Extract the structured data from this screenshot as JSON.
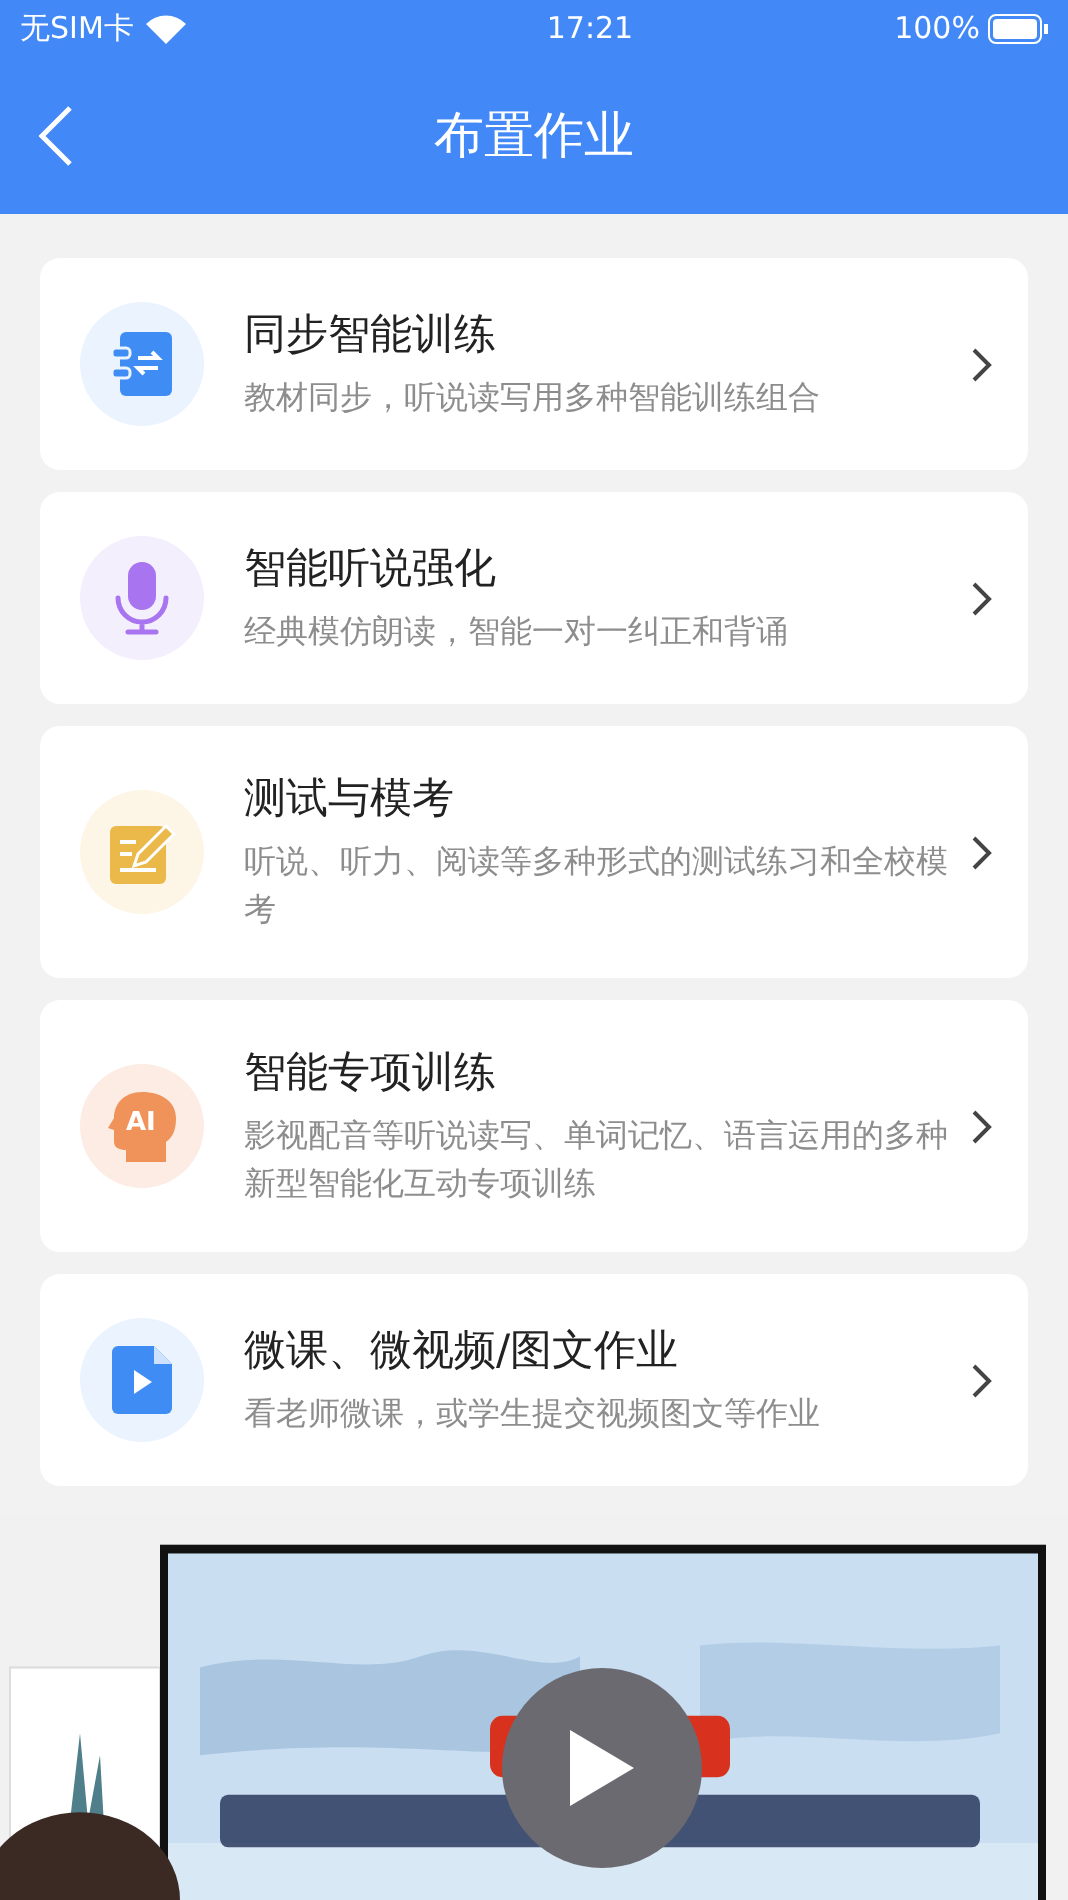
{
  "status_bar": {
    "carrier": "无SIM卡",
    "time": "17:21",
    "battery": "100%"
  },
  "nav": {
    "title": "布置作业"
  },
  "items": [
    {
      "kind": "book",
      "title": "同步智能训练",
      "subtitle": "教材同步，听说读写用多种智能训练组合"
    },
    {
      "kind": "mic",
      "title": "智能听说强化",
      "subtitle": "经典模仿朗读，智能一对一纠正和背诵"
    },
    {
      "kind": "edit",
      "title": "测试与模考",
      "subtitle": "听说、听力、阅读等多种形式的测试练习和全校模考"
    },
    {
      "kind": "ai",
      "title": "智能专项训练",
      "subtitle": "影视配音等听说读写、单词记忆、语言运用的多种新型智能化互动专项训练",
      "icon_text": "AI"
    },
    {
      "kind": "video",
      "title": "微课、微视频/图文作业",
      "subtitle": "看老师微课，或学生提交视频图文等作业"
    }
  ]
}
